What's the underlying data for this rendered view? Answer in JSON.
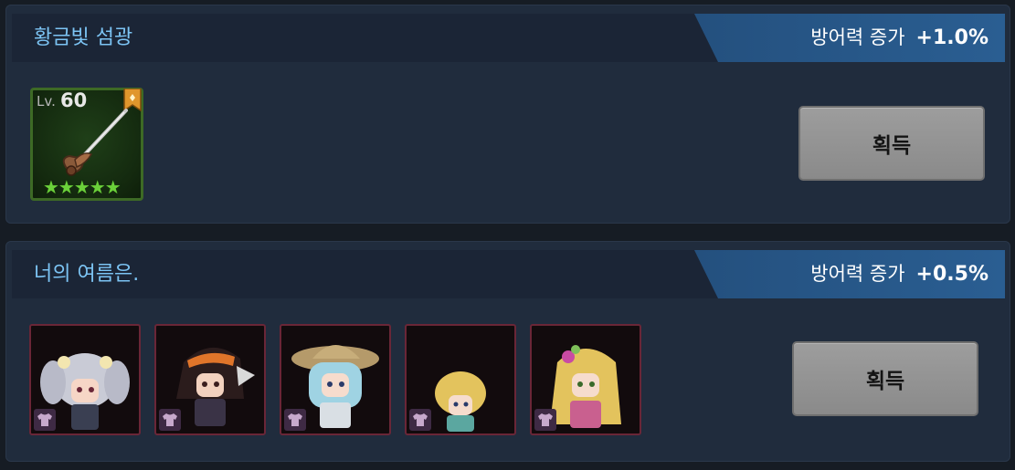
{
  "panels": [
    {
      "title": "황금빛 섬광",
      "stat_name": "방어력 증가",
      "stat_value": "+1.0%",
      "item": {
        "level_prefix": "Lv.",
        "level": "60",
        "stars": "★★★★★",
        "icon": "sword-icon"
      },
      "button_label": "획득"
    },
    {
      "title": "너의 여름은.",
      "stat_name": "방어력 증가",
      "stat_value": "+0.5%",
      "costumes": [
        {
          "icon": "character-costume-icon"
        },
        {
          "icon": "character-costume-icon"
        },
        {
          "icon": "character-costume-icon"
        },
        {
          "icon": "character-costume-icon"
        },
        {
          "icon": "character-costume-icon"
        }
      ],
      "button_label": "획득"
    }
  ],
  "colors": {
    "title": "#7cc4f4",
    "stat_bg": "#2a5e92",
    "item_border": "#3d6a25",
    "costume_border": "#6a2637",
    "button_bg": "#9d9d9d"
  }
}
